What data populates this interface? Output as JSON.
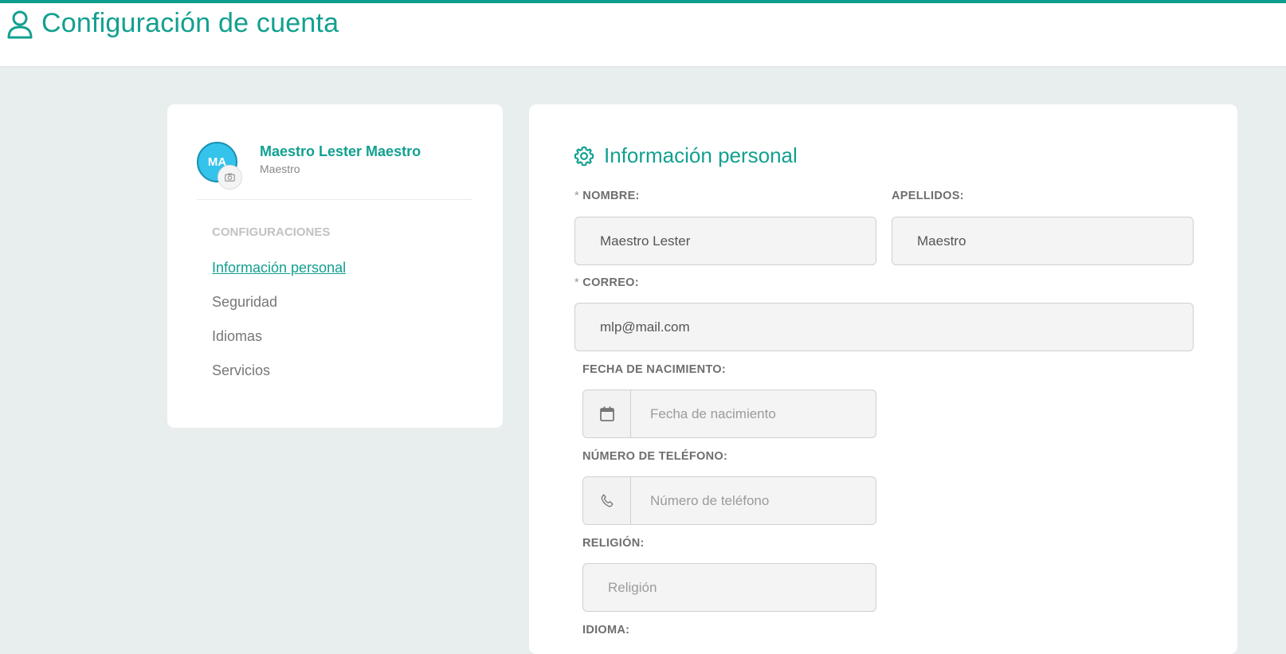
{
  "header": {
    "title": "Configuración de cuenta",
    "icon": "user-icon",
    "accent": "#0f9d8f"
  },
  "profile": {
    "initials": "MA",
    "name": "Maestro Lester Maestro",
    "role": "Maestro",
    "avatar_color": "#34c3ea"
  },
  "menu": {
    "heading": "CONFIGURACIONES",
    "items": [
      {
        "label": "Información personal",
        "active": true
      },
      {
        "label": "Seguridad",
        "active": false
      },
      {
        "label": "Idiomas",
        "active": false
      },
      {
        "label": "Servicios",
        "active": false
      }
    ]
  },
  "form": {
    "title": "Información personal",
    "required_mark": "*",
    "nombre": {
      "label": "NOMBRE:",
      "value": "Maestro Lester"
    },
    "apellidos": {
      "label": "APELLIDOS:",
      "value": "Maestro"
    },
    "correo": {
      "label": "CORREO:",
      "value": "mlp@mail.com"
    },
    "fecha": {
      "label": "FECHA DE NACIMIENTO:",
      "placeholder": "Fecha de nacimiento",
      "icon": "calendar-icon"
    },
    "telefono": {
      "label": "NÚMERO DE TELÉFONO:",
      "placeholder": "Número de teléfono",
      "icon": "phone-icon"
    },
    "religion": {
      "label": "RELIGIÓN:",
      "placeholder": "Religión"
    },
    "idioma": {
      "label": "IDIOMA:"
    }
  }
}
